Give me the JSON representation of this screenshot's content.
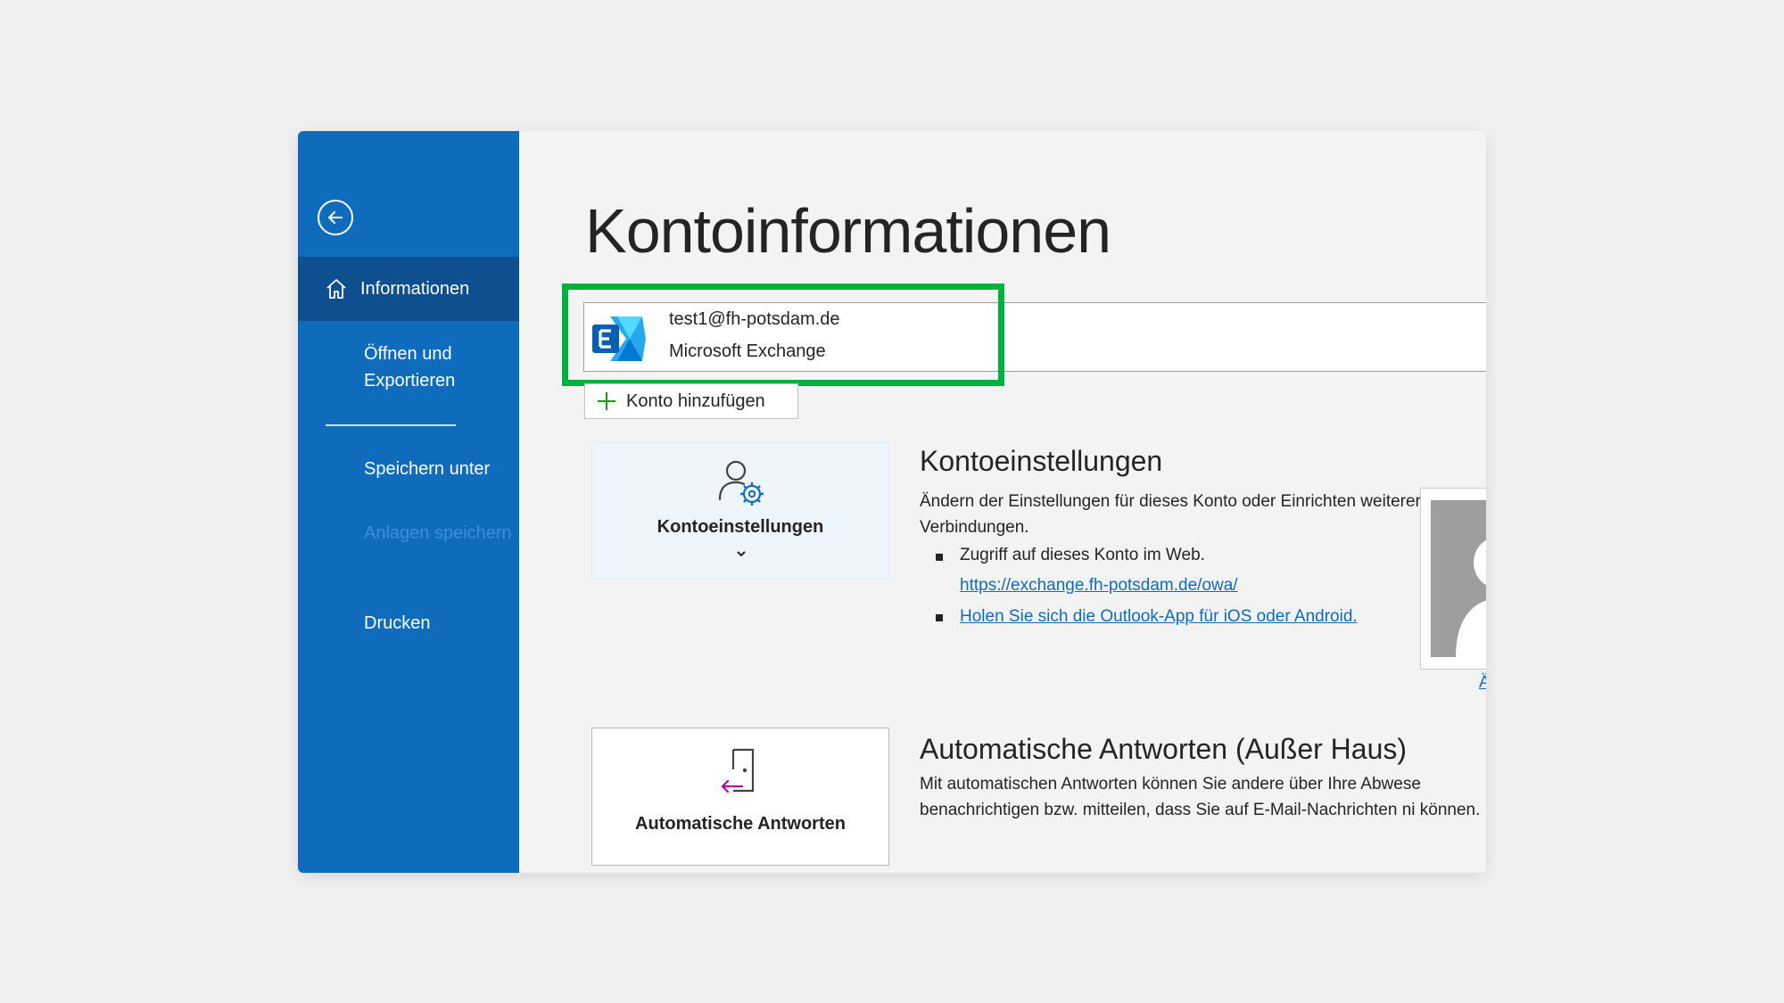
{
  "sidebar": {
    "back_label": "",
    "items": [
      {
        "label": "Informationen",
        "active": true
      },
      {
        "label": "Öffnen und Exportieren"
      },
      {
        "label": "Speichern unter"
      },
      {
        "label": "Anlagen speichern",
        "disabled": true
      },
      {
        "label": "Drucken"
      }
    ]
  },
  "main": {
    "title": "Kontoinformationen",
    "account": {
      "email": "test1@fh-potsdam.de",
      "type": "Microsoft Exchange"
    },
    "add_account_label": "Konto hinzufügen",
    "settings_tile": {
      "label": "Kontoeinstellungen"
    },
    "settings_section": {
      "title": "Kontoeinstellungen",
      "description": "Ändern der Einstellungen für dieses Konto oder Einrichten weiterer Verbindungen.",
      "bullet1": "Zugriff auf dieses Konto im Web.",
      "link1": "https://exchange.fh-potsdam.de/owa/",
      "link2": "Holen Sie sich die Outlook-App für iOS oder Android."
    },
    "profile_link": "Ä",
    "auto_tile": {
      "label": "Automatische Antworten"
    },
    "auto_section": {
      "title": "Automatische Antworten (Außer Haus)",
      "description": "Mit automatischen Antworten können Sie andere über Ihre Abwese benachrichtigen bzw. mitteilen, dass Sie auf E-Mail-Nachrichten ni können."
    }
  },
  "colors": {
    "sidebar": "#0f6cbd",
    "sidebar_active": "#0d4f8f",
    "highlight": "#00b140",
    "link": "#0f6cbd"
  }
}
